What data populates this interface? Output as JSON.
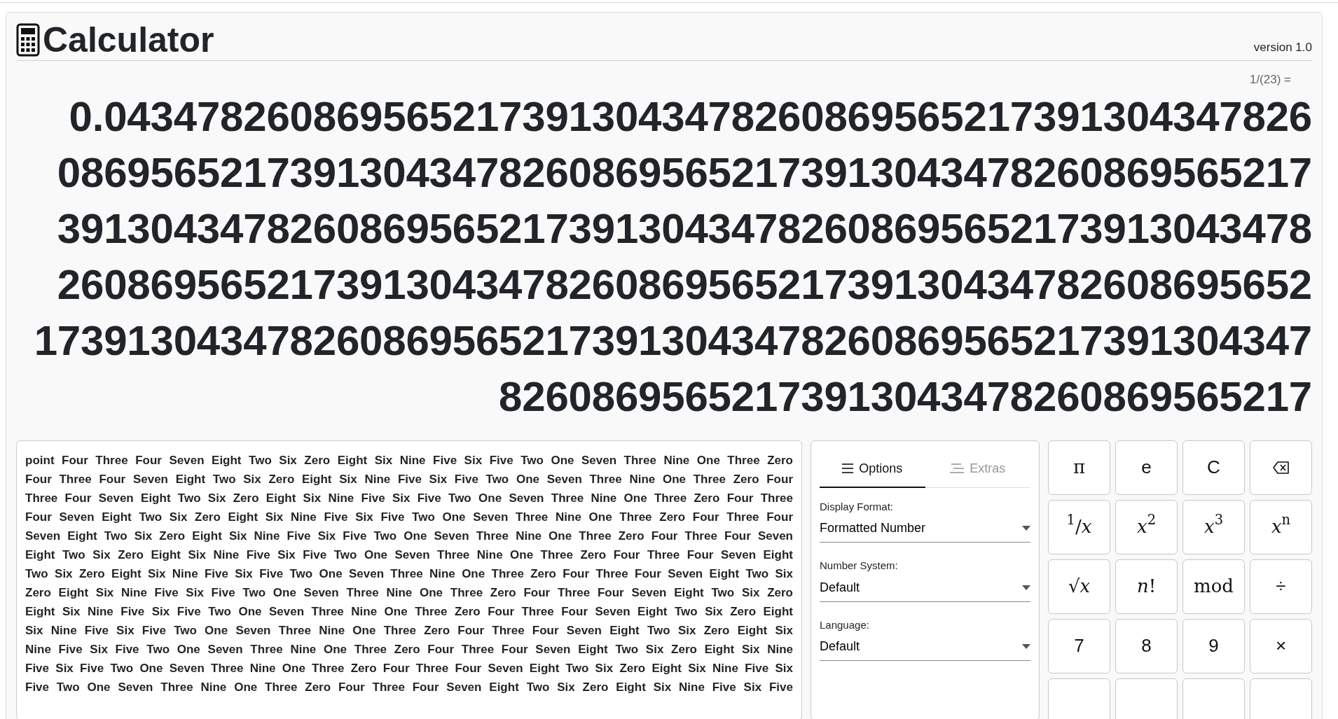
{
  "app": {
    "title": "Calculator",
    "version": "version 1.0"
  },
  "expression": "1/(23) =",
  "result_lines": [
    "0.0434782608695652173913043478260869565217391304347826",
    "086956521739130434782608695652173913043478260869565217",
    "391304347826086956521739130434782608695652173913043478",
    "260869565217391304347826086956521739130434782608695652",
    "1739130434782608695652173913043478260869565217391304347",
    "82608695652173913043478260869565217"
  ],
  "words": {
    "lines": [
      "point Four Three Four Seven Eight Two Six Zero Eight Six Nine Five Six Five Two One Seven Three Nine One Three Zero",
      "Four Three Four Seven Eight Two Six Zero Eight Six Nine Five Six Five Two One Seven Three Nine One Three Zero Four",
      "Three Four Seven Eight Two Six Zero Eight Six Nine Five Six Five Two One Seven Three Nine One Three Zero Four Three",
      "Four Seven Eight Two Six Zero Eight Six Nine Five Six Five Two One Seven Three Nine One Three Zero Four Three Four",
      "Seven Eight Two Six Zero Eight Six Nine Five Six Five Two One Seven Three Nine One Three Zero Four Three Four Seven",
      "Eight Two Six Zero Eight Six Nine Five Six Five Two One Seven Three Nine One Three Zero Four Three Four Seven Eight",
      "Two Six Zero Eight Six Nine Five Six Five Two One Seven Three Nine One Three Zero Four Three Four Seven Eight Two Six",
      "Zero Eight Six Nine Five Six Five Two One Seven Three Nine One Three Zero Four Three Four Seven Eight Two Six Zero",
      "Eight Six Nine Five Six Five Two One Seven Three Nine One Three Zero Four Three Four Seven Eight Two Six Zero Eight",
      "Six Nine Five Six Five Two One Seven Three Nine One Three Zero Four Three Four Seven Eight Two Six Zero Eight Six",
      "Nine Five Six Five Two One Seven Three Nine One Three Zero Four Three Four Seven Eight Two Six Zero Eight Six Nine",
      "Five Six Five Two One Seven Three Nine One Three Zero Four Three Four Seven Eight Two Six Zero Eight Six Nine Five Six",
      "Five Two One Seven Three Nine One Three Zero Four Three Four Seven Eight Two Six Zero Eight Six Nine Five Six Five"
    ]
  },
  "options": {
    "tabs": [
      {
        "label": "Options",
        "selected": true
      },
      {
        "label": "Extras",
        "selected": false
      }
    ],
    "fields": [
      {
        "label": "Display Format:",
        "value": "Formatted Number"
      },
      {
        "label": "Number System:",
        "value": "Default"
      },
      {
        "label": "Language:",
        "value": "Default"
      }
    ]
  },
  "keypad": [
    {
      "kind": "math",
      "label": "π"
    },
    {
      "kind": "digit",
      "label": "e"
    },
    {
      "kind": "digit",
      "label": "C"
    },
    {
      "kind": "backspace"
    },
    {
      "kind": "math",
      "label": "$^{1}$/*x*"
    },
    {
      "kind": "math",
      "label": "*x*$^{2}$"
    },
    {
      "kind": "math",
      "label": "*x*$^{3}$"
    },
    {
      "kind": "math",
      "label": "*x*$^{n}$"
    },
    {
      "kind": "math",
      "label": "√*x*"
    },
    {
      "kind": "math",
      "label": "*n*!"
    },
    {
      "kind": "math",
      "label": "mod"
    },
    {
      "kind": "digit",
      "label": "÷"
    },
    {
      "kind": "digit",
      "label": "7"
    },
    {
      "kind": "digit",
      "label": "8"
    },
    {
      "kind": "digit",
      "label": "9"
    },
    {
      "kind": "digit",
      "label": "×"
    },
    {
      "kind": "blank"
    },
    {
      "kind": "blank"
    },
    {
      "kind": "blank"
    },
    {
      "kind": "blank"
    }
  ]
}
